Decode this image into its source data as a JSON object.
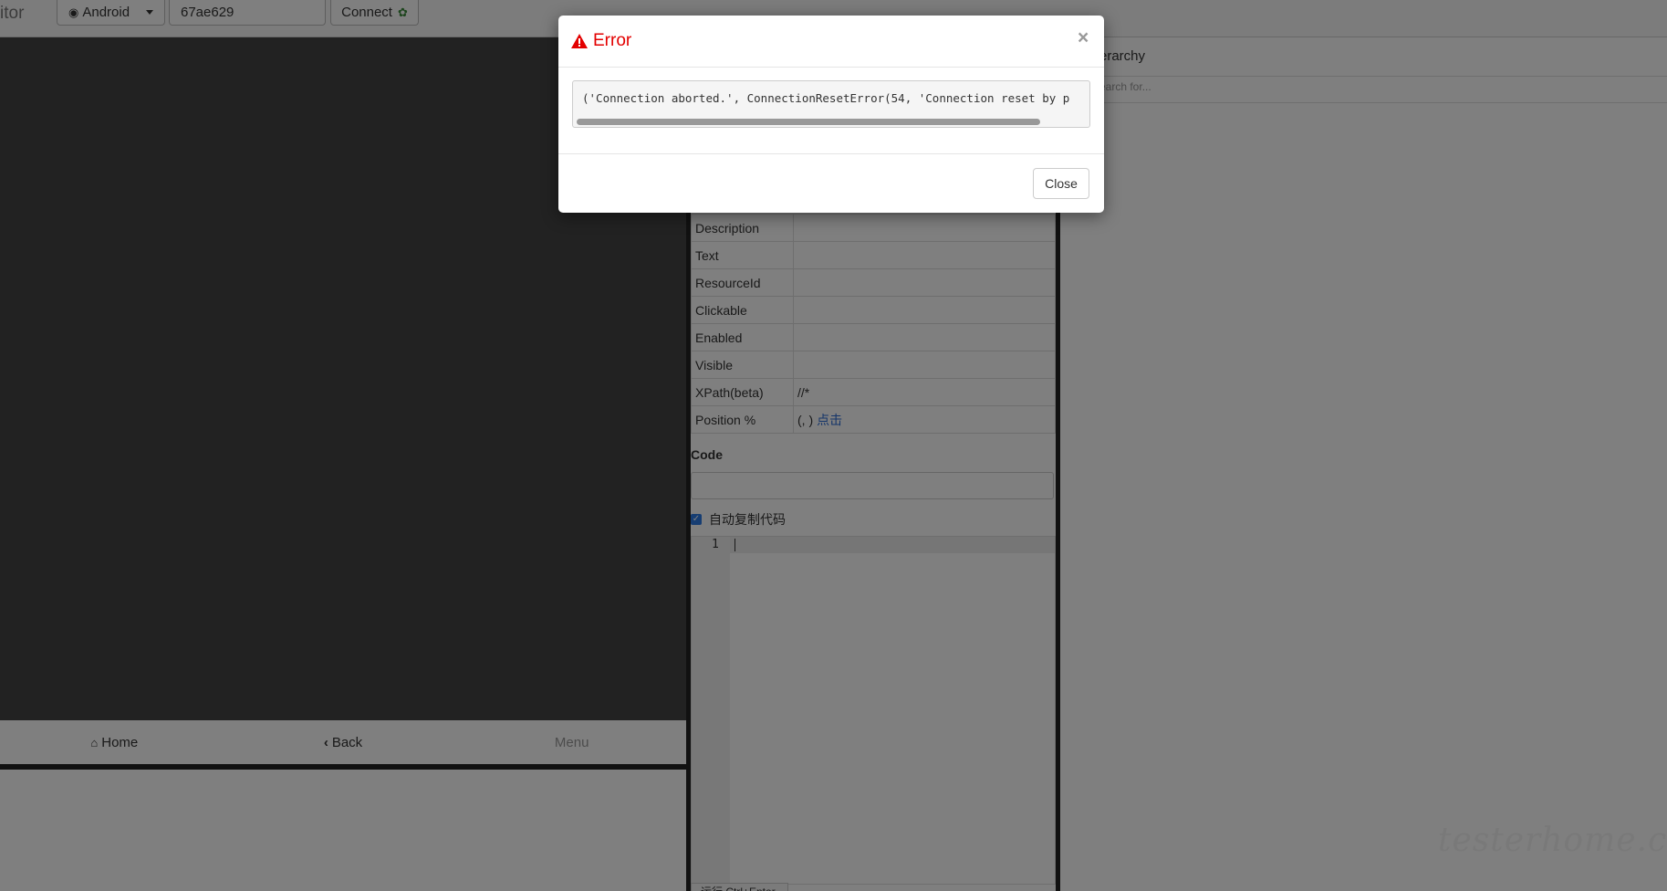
{
  "navbar": {
    "brand": "itor",
    "platform": "Android",
    "serial": "67ae629",
    "connect_label": "Connect"
  },
  "device": {
    "controls": [
      {
        "icon": "home-icon",
        "label": "Home"
      },
      {
        "icon": "chevron-left-icon",
        "label": "Back"
      },
      {
        "label": "Menu"
      }
    ]
  },
  "properties": {
    "rows": [
      {
        "key": "Description",
        "value": ""
      },
      {
        "key": "Text",
        "value": ""
      },
      {
        "key": "ResourceId",
        "value": ""
      },
      {
        "key": "Clickable",
        "value": ""
      },
      {
        "key": "Enabled",
        "value": ""
      },
      {
        "key": "Visible",
        "value": ""
      },
      {
        "key": "XPath(beta)",
        "value": "//*"
      },
      {
        "key": "Position %",
        "value": "(, )",
        "link": "点击"
      }
    ],
    "code_label": "Code",
    "autocopy_label": "自动复制代码",
    "editor_line": "1",
    "run_tab": "运行 Ctrl+Enter"
  },
  "hierarchy": {
    "title": "erarchy",
    "search_placeholder": "earch for..."
  },
  "modal": {
    "title": "Error",
    "message": "('Connection aborted.', ConnectionResetError(54, 'Connection reset by p",
    "close_label": "Close",
    "x_label": "×"
  },
  "watermark": "testerhome.com",
  "colors": {
    "error": "#e30000",
    "link": "#2a6ad4",
    "checkbox": "#2d7be5",
    "device_screen": "#444444"
  }
}
